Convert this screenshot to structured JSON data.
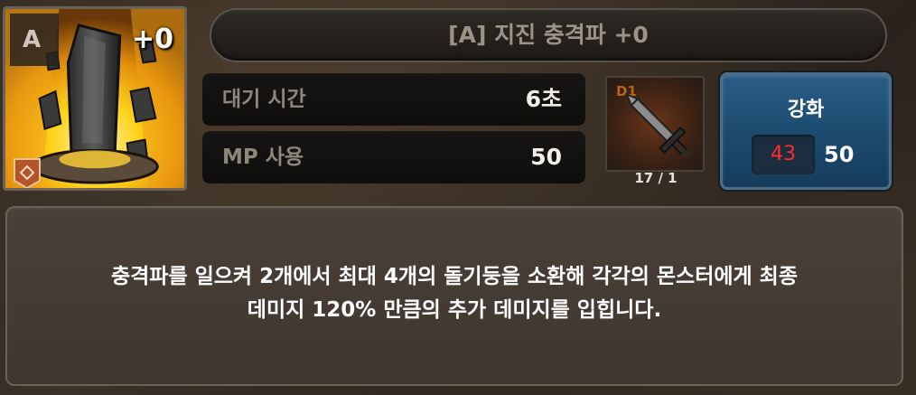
{
  "skill": {
    "grade": "A",
    "level": "+0",
    "title": "[A] 지진 충격파 +0",
    "icon": "earthquake-rock-pillar-icon"
  },
  "stats": {
    "cooldown_label": "대기 시간",
    "cooldown_value": "6초",
    "mp_label": "MP 사용",
    "mp_value": "50"
  },
  "material": {
    "tier": "D1",
    "count": "17 / 1",
    "icon": "sword-icon"
  },
  "upgrade": {
    "label": "강화",
    "cost_have": "43",
    "cost_need": "50"
  },
  "description": "충격파를 일으켜 2개에서 최대 4개의 돌기둥을 소환해 각각의 몬스터에게 최종\n데미지 120% 만큼의 추가 데미지를 입힙니다.",
  "colors": {
    "upgrade_button": "#1c4a6e",
    "insufficient": "#ff2a2a",
    "material_tier": "#b8641c"
  }
}
